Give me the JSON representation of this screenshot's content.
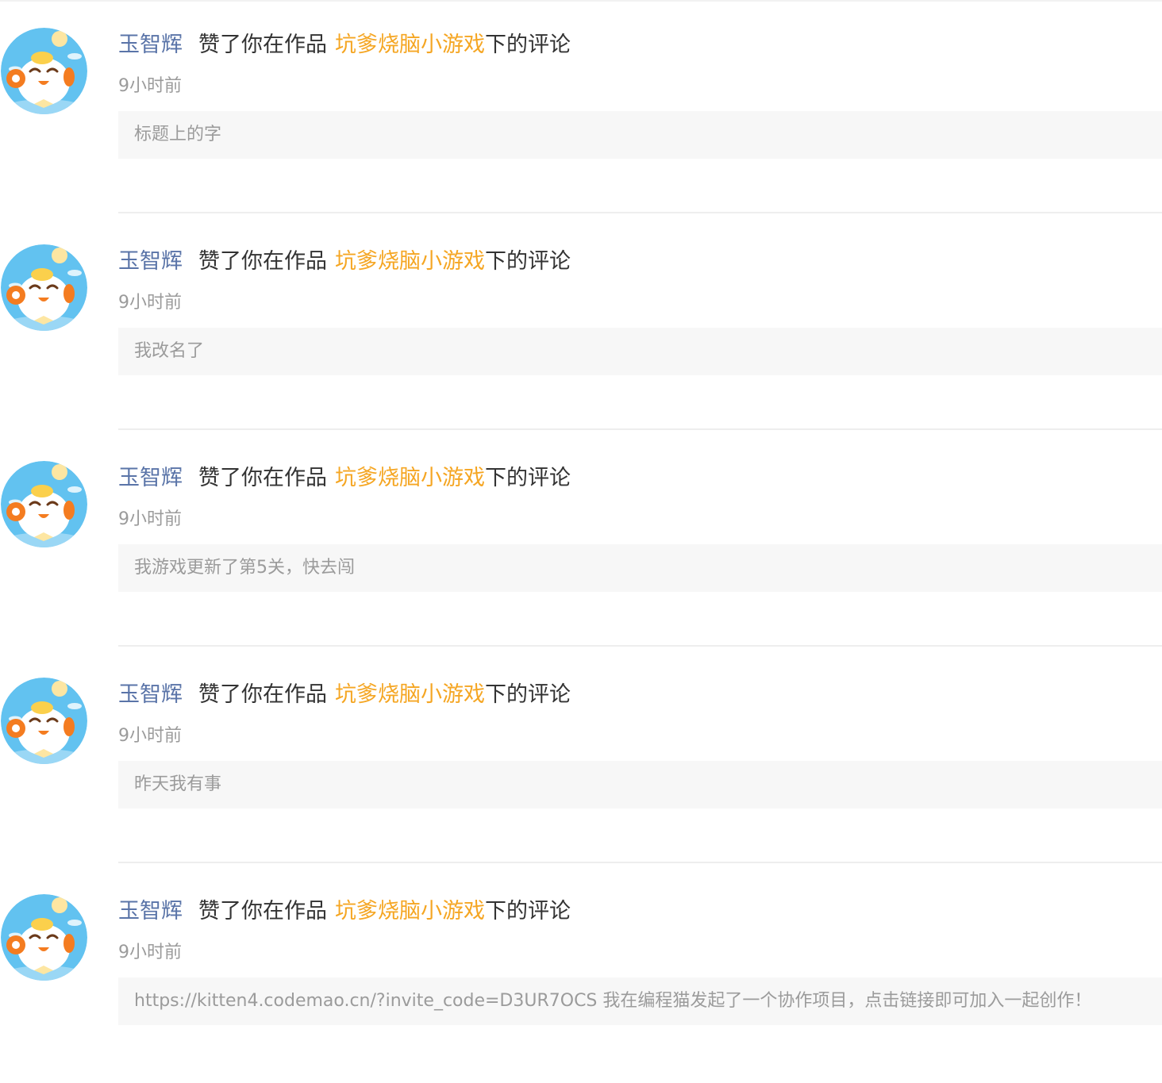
{
  "notifications": [
    {
      "username": "玉智辉",
      "action": "赞了你在作品",
      "work_title": "坑爹烧脑小游戏",
      "suffix": "下的评论",
      "time": "9小时前",
      "comment": "标题上的字",
      "avatar_icon": "cartoon-mascot-icon"
    },
    {
      "username": "玉智辉",
      "action": "赞了你在作品",
      "work_title": "坑爹烧脑小游戏",
      "suffix": "下的评论",
      "time": "9小时前",
      "comment": "我改名了",
      "avatar_icon": "cartoon-mascot-icon"
    },
    {
      "username": "玉智辉",
      "action": "赞了你在作品",
      "work_title": "坑爹烧脑小游戏",
      "suffix": "下的评论",
      "time": "9小时前",
      "comment": "我游戏更新了第5关，快去闯",
      "avatar_icon": "cartoon-mascot-icon"
    },
    {
      "username": "玉智辉",
      "action": "赞了你在作品",
      "work_title": "坑爹烧脑小游戏",
      "suffix": "下的评论",
      "time": "9小时前",
      "comment": "昨天我有事",
      "avatar_icon": "cartoon-mascot-icon"
    },
    {
      "username": "玉智辉",
      "action": "赞了你在作品",
      "work_title": "坑爹烧脑小游戏",
      "suffix": "下的评论",
      "time": "9小时前",
      "comment": "https://kitten4.codemao.cn/?invite_code=D3UR7OCS 我在编程猫发起了一个协作项目，点击链接即可加入一起创作！",
      "avatar_icon": "cartoon-mascot-icon"
    }
  ],
  "colors": {
    "username": "#5a74a8",
    "work_title": "#f5a623",
    "text": "#333333",
    "muted": "#9b9b9b",
    "comment_bg": "#f7f7f7",
    "divider": "#eeeeee"
  }
}
